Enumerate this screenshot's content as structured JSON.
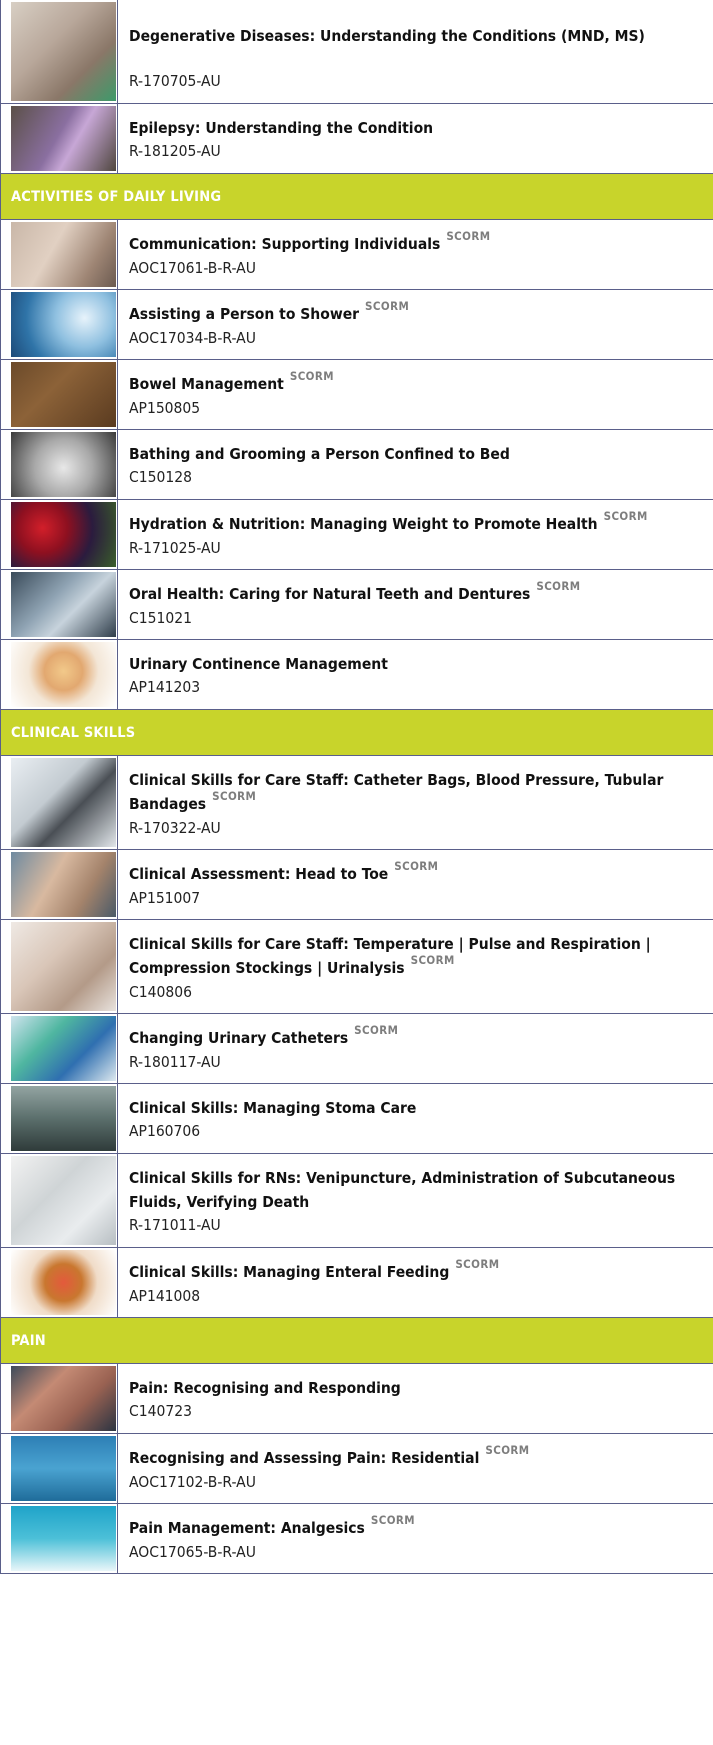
{
  "rows": [
    {
      "kind": "course",
      "title": "Degenerative  Diseases: Understanding the Conditions (MND, MS)",
      "code": "R-170705-AU",
      "scorm": "",
      "thumb": "elderly-woman-photo",
      "img": "linear-gradient(135deg,#d8cfc4 0%,#b8a79a 40%,#8a7768 70%,#3d9a6a 100%)",
      "h": 104
    },
    {
      "kind": "course",
      "title": "Epilepsy: Understanding the Condition",
      "code": "R-181205-AU",
      "scorm": "",
      "thumb": "purple-ribbon-hand-photo",
      "img": "linear-gradient(120deg,#5b5048 0%,#8a6fa0 45%,#c7a7d6 60%,#4f463f 100%)",
      "h": 70
    },
    {
      "kind": "section",
      "label": "ACTIVITIES OF DAILY LIVING"
    },
    {
      "kind": "course",
      "title": "Communication: Supporting Individuals",
      "code": "AOC17061-B-R-AU",
      "scorm": "SCORM",
      "thumb": "ear-listening-photo",
      "img": "linear-gradient(120deg,#c9b7a8 0%,#e1d0c2 40%,#9e8574 75%,#6b5a50 100%)",
      "h": 70
    },
    {
      "kind": "course",
      "title": "Assisting a Person to Shower",
      "code": "AOC17034-B-R-AU",
      "scorm": "SCORM",
      "thumb": "shower-head-photo",
      "img": "radial-gradient(circle at 70% 40%,#e7f3fb 0%,#8fc0e0 35%,#2f74a8 70%,#1d4a78 100%)",
      "h": 70
    },
    {
      "kind": "course",
      "title": "Bowel Management",
      "code": "AP150805",
      "scorm": "SCORM",
      "thumb": "toilet-sign-photo",
      "img": "linear-gradient(135deg,#6b4a2a 0%,#8c6238 40%,#5a3b20 100%)",
      "h": 70
    },
    {
      "kind": "course",
      "title": "Bathing and Grooming a Person Confined to Bed",
      "code": "C150128",
      "scorm": "",
      "thumb": "hands-washing-photo",
      "img": "radial-gradient(circle at 50% 55%,#e8e8e8 0%,#a9a9a9 45%,#3a3a3a 100%)",
      "h": 70
    },
    {
      "kind": "course",
      "title": "Hydration & Nutrition: Managing Weight to Promote Health",
      "code": "R-171025-AU",
      "scorm": "SCORM",
      "thumb": "berries-photo",
      "img": "radial-gradient(circle at 30% 40%,#d21f2a 0%,#8e1020 30%,#2b1b3e 60%,#3a5f2a 100%)",
      "h": 70
    },
    {
      "kind": "course",
      "title": "Oral Health: Caring for Natural Teeth and Dentures",
      "code": "C151021",
      "scorm": "SCORM",
      "thumb": "dentures-photo",
      "img": "linear-gradient(135deg,#3a4b5a 0%,#8fa3b3 40%,#c7d3dc 60%,#2f3d4a 100%)",
      "h": 70
    },
    {
      "kind": "course",
      "title": "Urinary Continence Management",
      "code": "AP141203",
      "scorm": "",
      "thumb": "bladder-illustration",
      "img": "radial-gradient(circle at 50% 45%,#f2c98a 0%,#e2a870 30%,#f3e6d6 55%,#ffffff 100%)",
      "h": 70
    },
    {
      "kind": "section",
      "label": "CLINICAL SKILLS"
    },
    {
      "kind": "course",
      "title": "Clinical Skills for Care Staff: Catheter Bags, Blood Pressure, Tubular Bandages",
      "code": "R-170322-AU",
      "scorm": "SCORM",
      "thumb": "blood-pressure-cuff-photo",
      "img": "linear-gradient(135deg,#e9eef2 0%,#c3cbd1 40%,#4a4f55 60%,#e1e6ea 100%)",
      "h": 94
    },
    {
      "kind": "course",
      "title": "Clinical Assessment: Head to Toe",
      "code": "AP151007",
      "scorm": "SCORM",
      "thumb": "ear-examination-photo",
      "img": "linear-gradient(120deg,#6e8aa0 0%,#d8b9a0 40%,#a4836b 70%,#4a5a68 100%)",
      "h": 70
    },
    {
      "kind": "course",
      "title": "Clinical Skills for Care Staff: Temperature | Pulse and Respiration | Compression Stockings | Urinalysis",
      "code": "C140806",
      "scorm": "SCORM",
      "thumb": "pulse-check-photo",
      "img": "linear-gradient(135deg,#efe9e4 0%,#d9c6b8 40%,#b39a88 70%,#e8e2dd 100%)",
      "h": 94
    },
    {
      "kind": "course",
      "title": "Changing Urinary Catheters",
      "code": "R-180117-AU",
      "scorm": "SCORM",
      "thumb": "catheter-kit-photo",
      "img": "linear-gradient(135deg,#cfe4ee 0%,#4fb6a0 35%,#2f6fb0 65%,#dde9ef 100%)",
      "h": 70
    },
    {
      "kind": "course",
      "title": "Clinical Skills: Managing Stoma Care",
      "code": "AP160706",
      "scorm": "",
      "thumb": "stoma-care-title-card",
      "img": "linear-gradient(180deg,#93a4a2 0%,#5b6f6c 50%,#2f3b3a 100%)",
      "h": 70
    },
    {
      "kind": "course",
      "title": "Clinical Skills for RNs: Venipuncture, Administration of Subcutaneous Fluids, Verifying Death",
      "code": "R-171011-AU",
      "scorm": "",
      "thumb": "iv-bag-photo",
      "img": "linear-gradient(135deg,#f2f2f2 0%,#cfd4d6 40%,#e9ecee 70%,#b7bec2 100%)",
      "h": 94
    },
    {
      "kind": "course",
      "title": "Clinical Skills: Managing Enteral Feeding",
      "code": "AP141008",
      "scorm": "SCORM",
      "thumb": "digestive-system-illustration",
      "img": "radial-gradient(circle at 50% 50%,#e35a3c 0%,#c9772f 30%,#f0dcc8 55%,#ffffff 100%)",
      "h": 70
    },
    {
      "kind": "section",
      "label": "PAIN"
    },
    {
      "kind": "course",
      "title": "Pain: Recognising and Responding",
      "code": "C140723",
      "scorm": "",
      "thumb": "elderly-man-pain-photo",
      "img": "linear-gradient(135deg,#3d4a5a 0%,#c48a74 35%,#9a6252 65%,#2b3442 100%)",
      "h": 70
    },
    {
      "kind": "course",
      "title": "Recognising and Assessing Pain: Residential",
      "code": "AOC17102-B-R-AU",
      "scorm": "SCORM",
      "thumb": "exclamation-mark-photo",
      "img": "linear-gradient(180deg,#2d7fb5 0%,#4aa3d1 50%,#1f6c9a 100%)",
      "h": 70
    },
    {
      "kind": "course",
      "title": "Pain Management: Analgesics",
      "code": "AOC17065-B-R-AU",
      "scorm": "SCORM",
      "thumb": "medicine-bottles-photo",
      "img": "linear-gradient(180deg,#1fa3c9 0%,#4cc0d8 50%,#e9f6f9 100%)",
      "h": 70
    }
  ]
}
